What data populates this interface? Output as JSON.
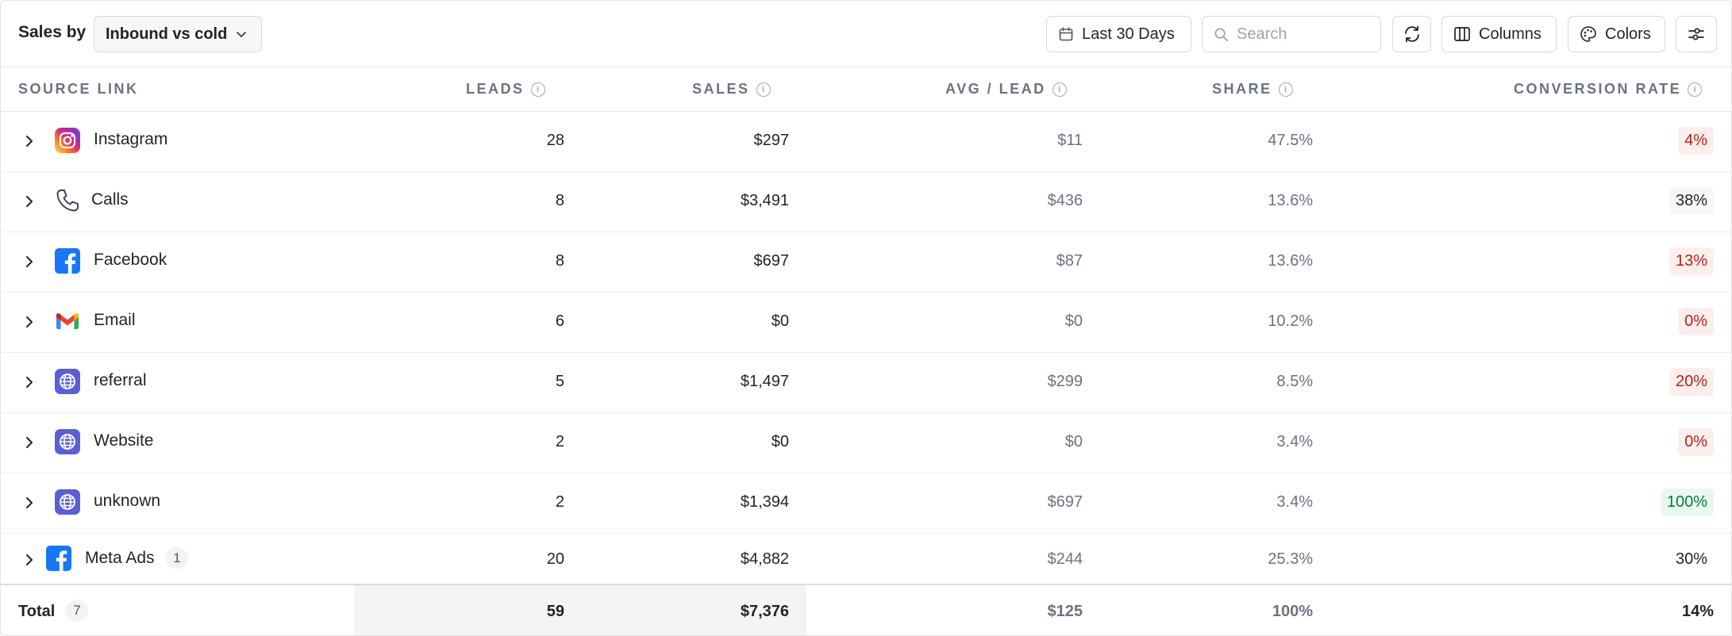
{
  "toolbar": {
    "sales_by_label": "Sales by",
    "group_by_value": "Inbound vs cold",
    "date_range_label": "Last 30 Days",
    "search_placeholder": "Search",
    "columns_label": "Columns",
    "colors_label": "Colors"
  },
  "table": {
    "headers": {
      "source": "SOURCE LINK",
      "leads": "LEADS",
      "sales": "SALES",
      "avg": "AVG / LEAD",
      "share": "SHARE",
      "conversion": "CONVERSION RATE"
    },
    "rows": [
      {
        "name": "Instagram",
        "icon": "instagram-icon",
        "leads": "28",
        "sales": "$297",
        "avg": "$11",
        "share": "47.5%",
        "conversion": "4%",
        "conv_style": "red"
      },
      {
        "name": "Calls",
        "icon": "phone-icon",
        "leads": "8",
        "sales": "$3,491",
        "avg": "$436",
        "share": "13.6%",
        "conversion": "38%",
        "conv_style": "plain"
      },
      {
        "name": "Facebook",
        "icon": "facebook-icon",
        "leads": "8",
        "sales": "$697",
        "avg": "$87",
        "share": "13.6%",
        "conversion": "13%",
        "conv_style": "red"
      },
      {
        "name": "Email",
        "icon": "gmail-icon",
        "leads": "6",
        "sales": "$0",
        "avg": "$0",
        "share": "10.2%",
        "conversion": "0%",
        "conv_style": "red"
      },
      {
        "name": "referral",
        "icon": "globe-icon",
        "leads": "5",
        "sales": "$1,497",
        "avg": "$299",
        "share": "8.5%",
        "conversion": "20%",
        "conv_style": "red"
      },
      {
        "name": "Website",
        "icon": "globe-icon",
        "leads": "2",
        "sales": "$0",
        "avg": "$0",
        "share": "3.4%",
        "conversion": "0%",
        "conv_style": "red"
      },
      {
        "name": "unknown",
        "icon": "globe-icon",
        "leads": "2",
        "sales": "$1,394",
        "avg": "$697",
        "share": "3.4%",
        "conversion": "100%",
        "conv_style": "green"
      },
      {
        "name": "Meta Ads",
        "icon": "facebook-icon",
        "badge": "1",
        "leads": "20",
        "sales": "$4,882",
        "avg": "$244",
        "share": "25.3%",
        "conversion": "30%",
        "conv_style": "none"
      }
    ],
    "total": {
      "label": "Total",
      "count": "7",
      "leads": "59",
      "sales": "$7,376",
      "avg": "$125",
      "share": "100%",
      "conversion": "14%"
    }
  },
  "colors": {
    "instagram_gradient": [
      "#feda75",
      "#fa7e1e",
      "#d62976",
      "#962fbf",
      "#4f5bd5"
    ],
    "facebook": "#1877f2",
    "globe_badge": "#5b5fd6",
    "conv_red_bg": "#fdeeee",
    "conv_red_text": "#b42318",
    "conv_green_bg": "#e9f8f0",
    "conv_green_text": "#067647"
  }
}
